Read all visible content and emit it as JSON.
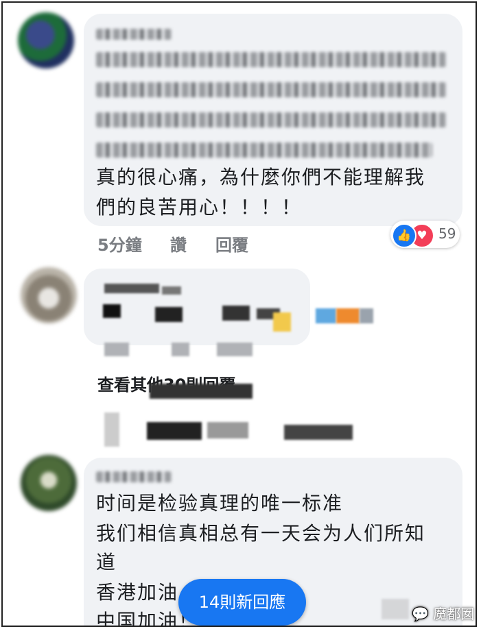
{
  "comment1": {
    "body_visible": "真的很心痛，為什麼你們不能理解我\n們的良苦用心！！！！",
    "line1": "真的很心痛，為什麼你們不能理解我",
    "line2": "們的良苦用心！！！！",
    "time": "5分鐘",
    "like_label": "讚",
    "reply_label": "回覆",
    "reaction_count": "59"
  },
  "comment2": {
    "view_more_label": "查看其他30則回覆"
  },
  "comment3": {
    "lines": [
      "时间是检验真理的唯一标准",
      "我们相信真相总有一天会为人们所知",
      "道",
      "香港加油",
      "中国加油！"
    ]
  },
  "new_replies_button": "14則新回應",
  "watermark": "魔都囡",
  "icons": {
    "like": "thumbs-up-icon",
    "love": "heart-icon",
    "watermark": "wechat-icon"
  },
  "colors": {
    "bubble": "#f0f2f5",
    "fb_blue": "#1877f2",
    "love_red": "#f33e58"
  }
}
